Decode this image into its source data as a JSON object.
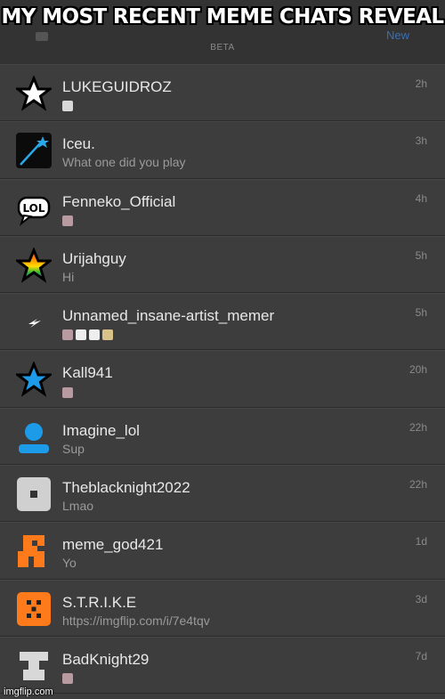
{
  "meme_caption": "MY MOST RECENT MEME CHATS REVEAL",
  "header": {
    "beta_label": "BETA",
    "right_action": "New"
  },
  "chats": [
    {
      "name": "LUKEGUIDROZ",
      "message": "",
      "time": "2h",
      "avatar": "white-star-icon"
    },
    {
      "name": "Iceu.",
      "message": "What one did you play",
      "time": "3h",
      "avatar": "shooting-star-icon"
    },
    {
      "name": "Fenneko_Official",
      "message": "",
      "time": "4h",
      "avatar": "lol-speech-bubble-icon"
    },
    {
      "name": "Urijahguy",
      "message": "Hi",
      "time": "5h",
      "avatar": "rainbow-star-icon"
    },
    {
      "name": "Unnamed_insane-artist_memer",
      "message": "",
      "time": "5h",
      "avatar": "lightning-bolt-icon"
    },
    {
      "name": "Kall941",
      "message": "",
      "time": "20h",
      "avatar": "blue-star-icon"
    },
    {
      "name": "Imagine_lol",
      "message": "Sup",
      "time": "22h",
      "avatar": "default-user-icon"
    },
    {
      "name": "Theblacknight2022",
      "message": "Lmao",
      "time": "22h",
      "avatar": "gray-square-icon"
    },
    {
      "name": "meme_god421",
      "message": "Yo",
      "time": "1d",
      "avatar": "orange-pixel-icon"
    },
    {
      "name": "S.T.R.I.K.E",
      "message": "https://imgflip.com/i/7e4tqv",
      "time": "3d",
      "avatar": "orange-checker-icon"
    },
    {
      "name": "BadKnight29",
      "message": "",
      "time": "7d",
      "avatar": "gray-pixel-icon"
    }
  ],
  "watermark": "imgflip.com",
  "colors": {
    "background": "#3d3d3d",
    "header": "#333333",
    "name_text": "#e8e8e8",
    "meta_text": "#8a8a8a"
  }
}
